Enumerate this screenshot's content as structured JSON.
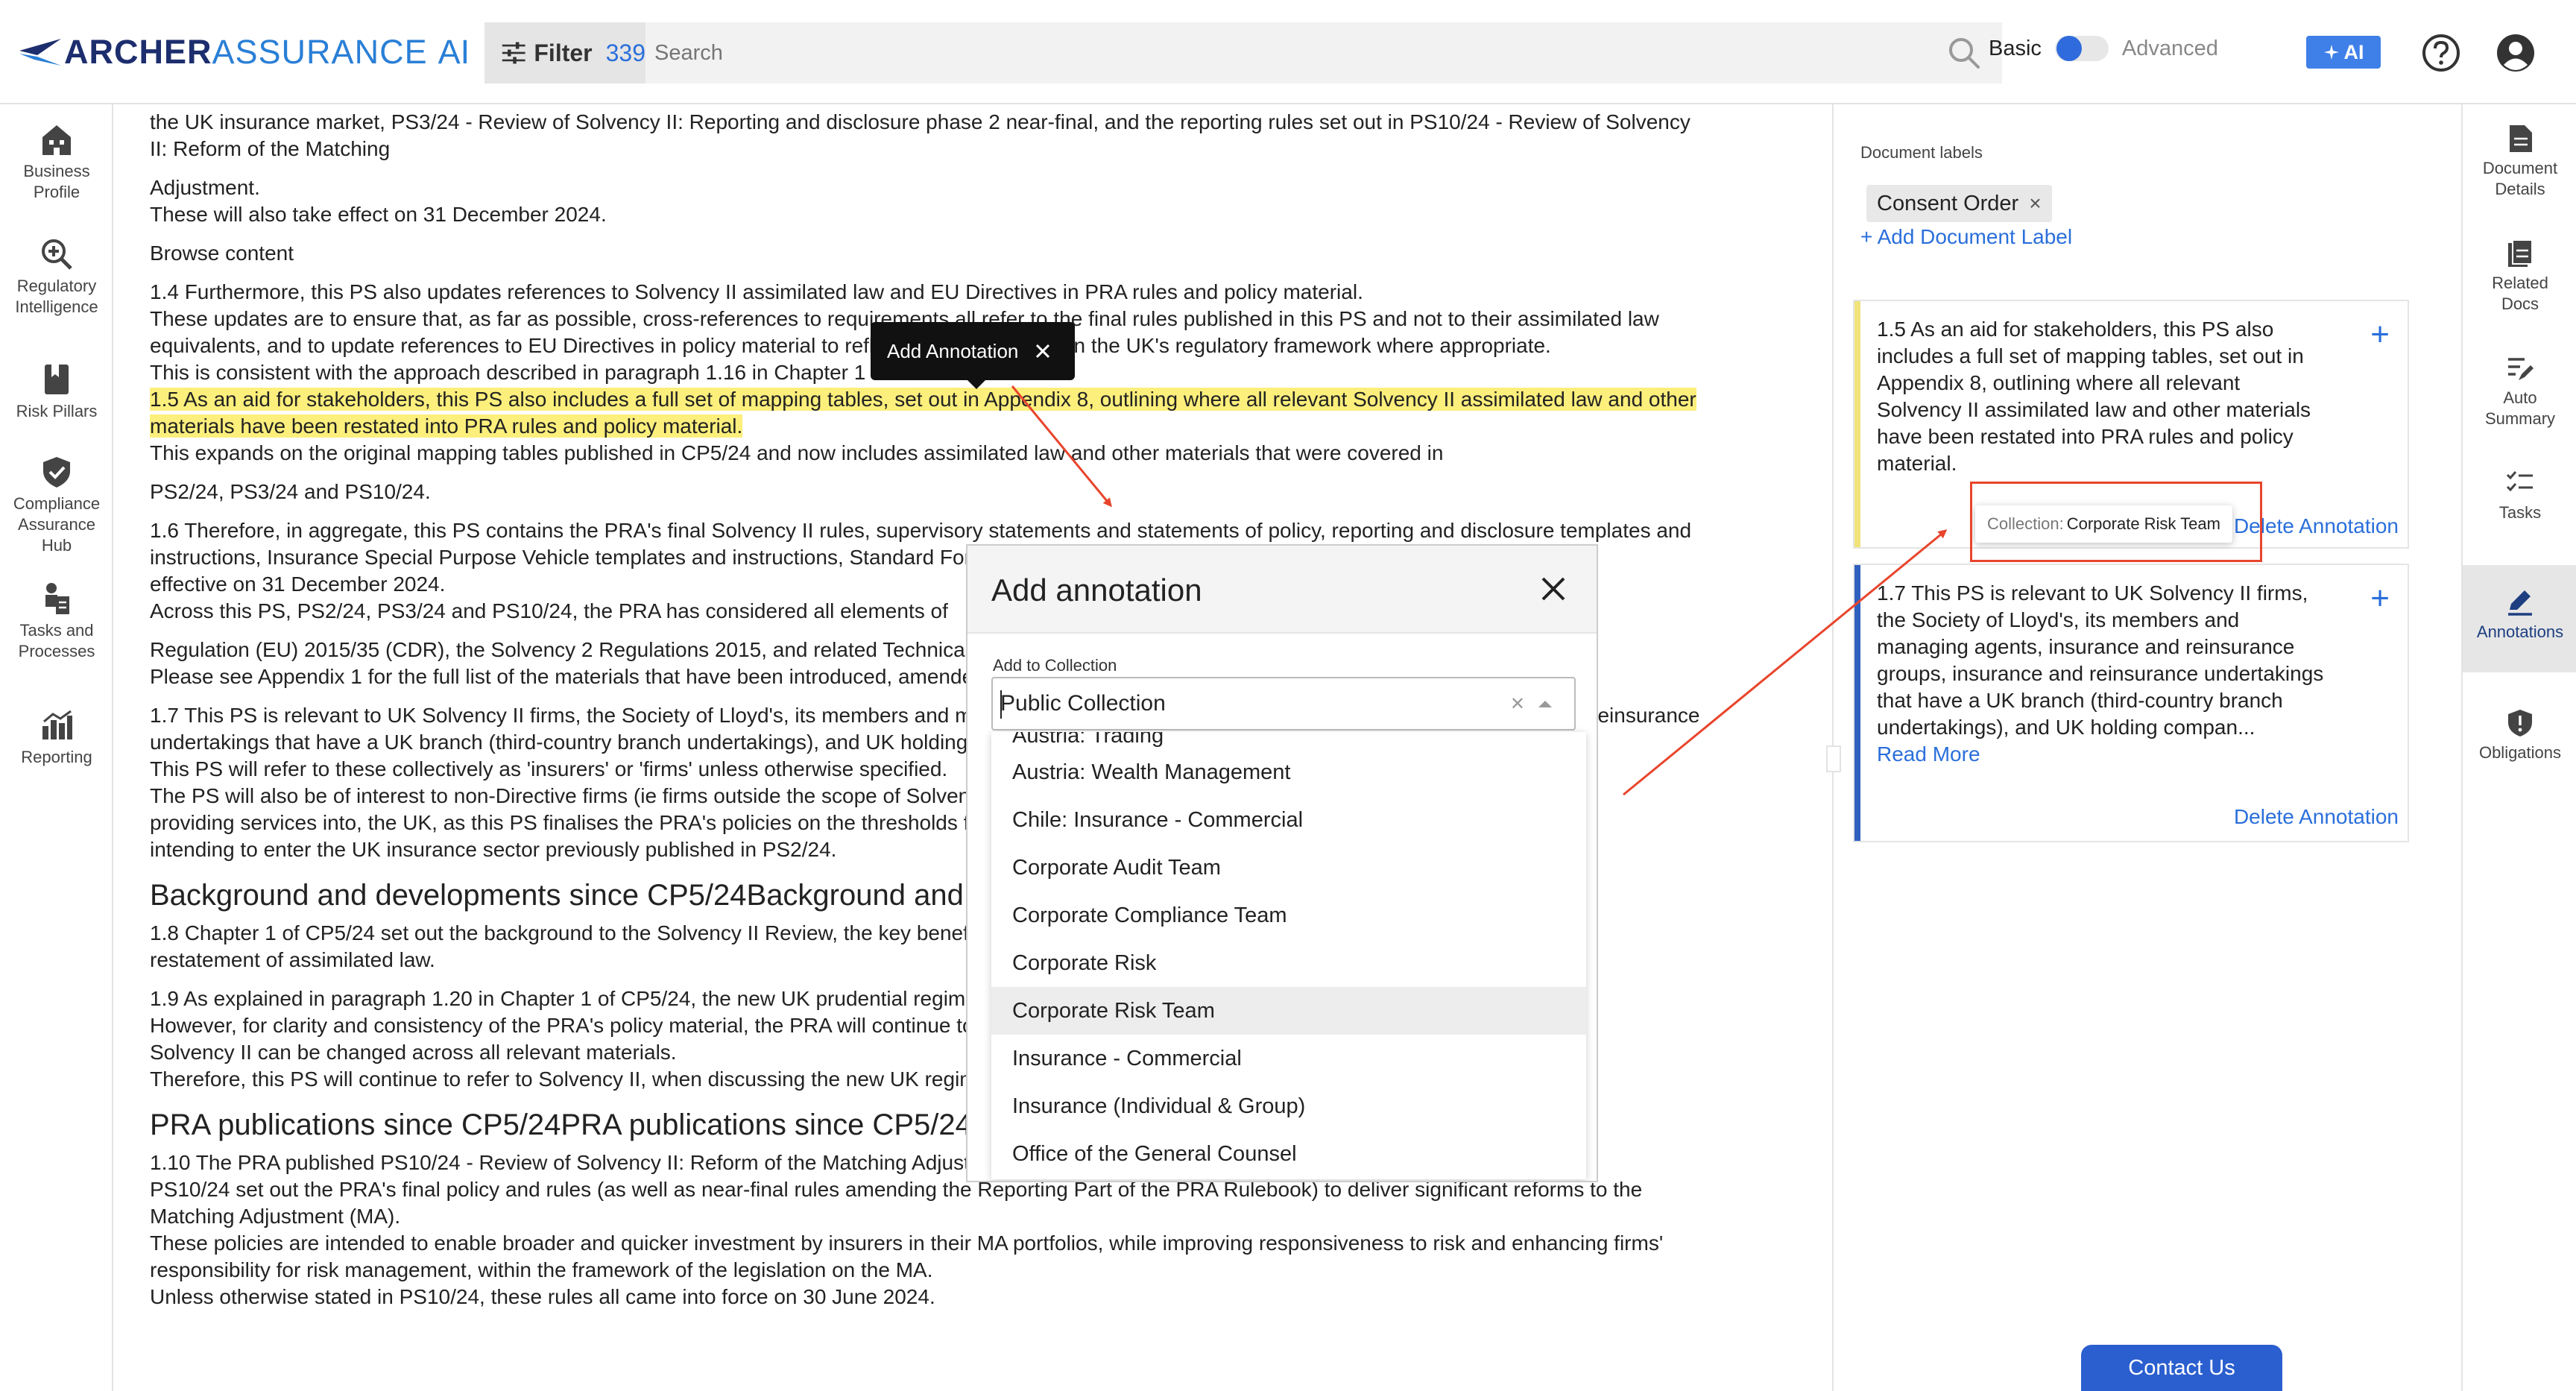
{
  "header": {
    "logo_primary": "ARCHER",
    "logo_secondary": "ASSURANCE",
    "logo_ai": "AI",
    "filter_label": "Filter",
    "filter_count": "339",
    "search_placeholder": "Search",
    "mode_basic": "Basic",
    "mode_advanced": "Advanced",
    "ai_button": "AI"
  },
  "left_nav": [
    {
      "label1": "Business",
      "label2": "Profile",
      "icon": "building-icon"
    },
    {
      "label1": "Regulatory",
      "label2": "Intelligence",
      "icon": "search-plus-icon"
    },
    {
      "label1": "Risk Pillars",
      "label2": "",
      "icon": "bookmark-icon"
    },
    {
      "label1": "Compliance",
      "label2": "Assurance",
      "label3": "Hub",
      "icon": "shield-check-icon"
    },
    {
      "label1": "Tasks and",
      "label2": "Processes",
      "icon": "person-clipboard-icon"
    },
    {
      "label1": "Reporting",
      "label2": "",
      "icon": "bar-chart-icon"
    }
  ],
  "right_nav": [
    {
      "label1": "Document",
      "label2": "Details",
      "icon": "document-icon"
    },
    {
      "label1": "Related",
      "label2": "Docs",
      "icon": "documents-icon"
    },
    {
      "label1": "Auto",
      "label2": "Summary",
      "icon": "edit-lines-icon"
    },
    {
      "label1": "Tasks",
      "label2": "",
      "icon": "checklist-icon"
    },
    {
      "label1": "Annotations",
      "label2": "",
      "icon": "pencil-icon"
    },
    {
      "label1": "Obligations",
      "label2": "",
      "icon": "shield-exclamation-icon"
    }
  ],
  "document": {
    "p1a": "the UK insurance market, PS3/24 - Review of Solvency II: Reporting and disclosure phase 2 near-final, and the reporting rules set out in PS10/24 - Review of Solvency",
    "p1b": "II: Reform of the Matching",
    "p2a": "Adjustment.",
    "p2b": "These will also take effect on 31 December 2024.",
    "p3": "Browse content",
    "p4a": "1.4 Furthermore, this PS also updates references to Solvency II assimilated law and EU Directives in PRA rules and policy material.",
    "p4b": "These updates are to ensure that, as far as possible, cross-references to requirements all refer to the final rules published in this PS and not to their assimilated law",
    "p4c": "equivalents, and to update references to EU Directives in policy material to reflect the UK's position in the UK's regulatory framework where appropriate.",
    "p4d": "This is consistent with the approach described in paragraph 1.16 in Chapter 1 of CP5/24.",
    "p5a": "1.5 As an aid for stakeholders, this PS also includes a full set of mapping tables, set out in Appendix 8, outlining where all relevant Solvency II assimilated law and other",
    "p5b": "materials have been restated into PRA rules and policy material.",
    "p5c": "This expands on the original mapping tables published in CP5/24 and now includes assimilated law and other materials that were covered in",
    "p6": "PS2/24, PS3/24 and PS10/24.",
    "p7a": "1.6 Therefore, in aggregate, this PS contains the PRA's final Solvency II rules, supervisory statements and statements of policy, reporting and disclosure templates and",
    "p7b": "instructions, Insurance Special Purpose Vehicle templates and instructions, Standard Formula model and other materials. Those are the materials that will be",
    "p7c": "effective on 31 December 2024.",
    "p7d": "Across this PS, PS2/24, PS3/24 and PS10/24, the PRA has considered all elements of",
    "p8a": "Regulation (EU) 2015/35 (CDR), the Solvency 2 Regulations 2015, and related Technical Standards",
    "p8b": "Please see Appendix 1 for the full list of the materials that have been introduced, amended or deleted.",
    "p9a": "1.7 This PS is relevant to UK Solvency II firms, the Society of Lloyd's, its members and managing agents, insurance and reinsurance groups, insurance and reinsurance",
    "p9b": "undertakings that have a UK branch (third-country branch undertakings), and UK holding companies.",
    "p9c": "This PS will refer to these collectively as 'insurers' or 'firms' unless otherwise specified.",
    "p9d": "The PS will also be of interest to non-Directive firms (ie firms outside the scope of Solvency II) regardless of the market they are operating in, or",
    "p9e": "providing services into, the UK, as this PS finalises the PRA's policies on the thresholds for Solvency II firms, and to prospective insurers",
    "p9f": "intending to enter the UK insurance sector previously published in PS2/24.",
    "h1": "Background and developments since CP5/24Background and developments since CP5/24",
    "p10a": "1.8 Chapter 1 of CP5/24 set out the background to the Solvency II Review, the key benefits of the reforms, and the scope of the",
    "p10b": "restatement of assimilated law.",
    "p11a": "1.9 As explained in paragraph 1.20 in Chapter 1 of CP5/24, the new UK prudential regime for insurers is referred to as Solvency UK.",
    "p11b": "However, for clarity and consistency of the PRA's policy material, the PRA will continue to refer to Solvency II until references to",
    "p11c": "Solvency II can be changed across all relevant materials.",
    "p11d": "Therefore, this PS will continue to refer to Solvency II, when discussing the new UK regime.",
    "h2": "PRA publications since CP5/24PRA publications since CP5/24",
    "p12a": "1.10 The PRA published PS10/24 - Review of Solvency II: Reform of the Matching Adjustment on 6 June 2024.",
    "p12b": "PS10/24 set out the PRA's final policy and rules (as well as near-final rules amending the Reporting Part of the PRA Rulebook) to deliver significant reforms to the",
    "p12c": "Matching Adjustment (MA).",
    "p12d": "These policies are intended to enable broader and quicker investment by insurers in their MA portfolios, while improving responsiveness to risk and enhancing firms'",
    "p12e": "responsibility for risk management, within the framework of the legislation on the MA.",
    "p12f": "Unless otherwise stated in PS10/24, these rules all came into force on 30 June 2024."
  },
  "annotation_tip": {
    "label": "Add Annotation"
  },
  "modal": {
    "title": "Add annotation",
    "collection_label": "Add to Collection",
    "selected": "Public Collection",
    "options_partial": "Austria: Trading",
    "options": [
      "Austria: Wealth Management",
      "Chile: Insurance - Commercial",
      "Corporate Audit Team",
      "Corporate Compliance Team",
      "Corporate Risk",
      "Corporate Risk Team",
      "Insurance - Commercial",
      "Insurance (Individual & Group)",
      "Office of the General Counsel"
    ],
    "highlighted_option_index": 5
  },
  "sidepanel": {
    "title": "Document labels",
    "label_chip": "Consent Order",
    "add_label": "+ Add Document Label",
    "cards": [
      {
        "lines": [
          "1.5 As an aid for stakeholders, this PS also",
          "includes a full set of mapping tables, set out in",
          "Appendix 8, outlining where all relevant",
          "Solvency II assimilated law and other materials",
          "have been restated into PRA rules and policy",
          "material."
        ],
        "delete": "Delete Annotation",
        "bar_color": "#f0e37a"
      },
      {
        "lines": [
          "1.7 This PS is relevant to UK Solvency II firms,",
          "the Society of Lloyd's, its members and",
          "managing agents, insurance and reinsurance",
          "groups, insurance and reinsurance undertakings",
          "that have a UK branch (third-country branch",
          "undertakings), and UK holding compan..."
        ],
        "read_more": "Read More",
        "delete": "Delete Annotation",
        "bar_color": "#2f5fbf"
      }
    ],
    "tooltip_key": "Collection:",
    "tooltip_value": "Corporate Risk Team"
  },
  "contact_button": "Contact Us",
  "colors": {
    "accent": "#2a6fdb",
    "highlight": "#fcef7c",
    "callout": "#e8452c"
  }
}
